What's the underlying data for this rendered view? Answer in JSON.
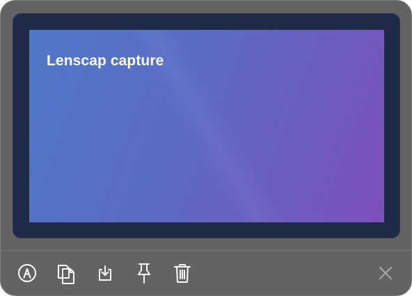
{
  "capture": {
    "title": "Lenscap capture"
  },
  "toolbar": {
    "icons": [
      "annotate-icon",
      "copy-icon",
      "save-icon",
      "pin-icon",
      "trash-icon",
      "close-icon"
    ]
  },
  "colors": {
    "window_bg": "#636363",
    "frame_bg": "#1f2a47",
    "gradient_start": "#4f78c9",
    "gradient_end": "#7d4fba",
    "icon": "#ffffff",
    "close_icon": "#a9a9a9"
  }
}
